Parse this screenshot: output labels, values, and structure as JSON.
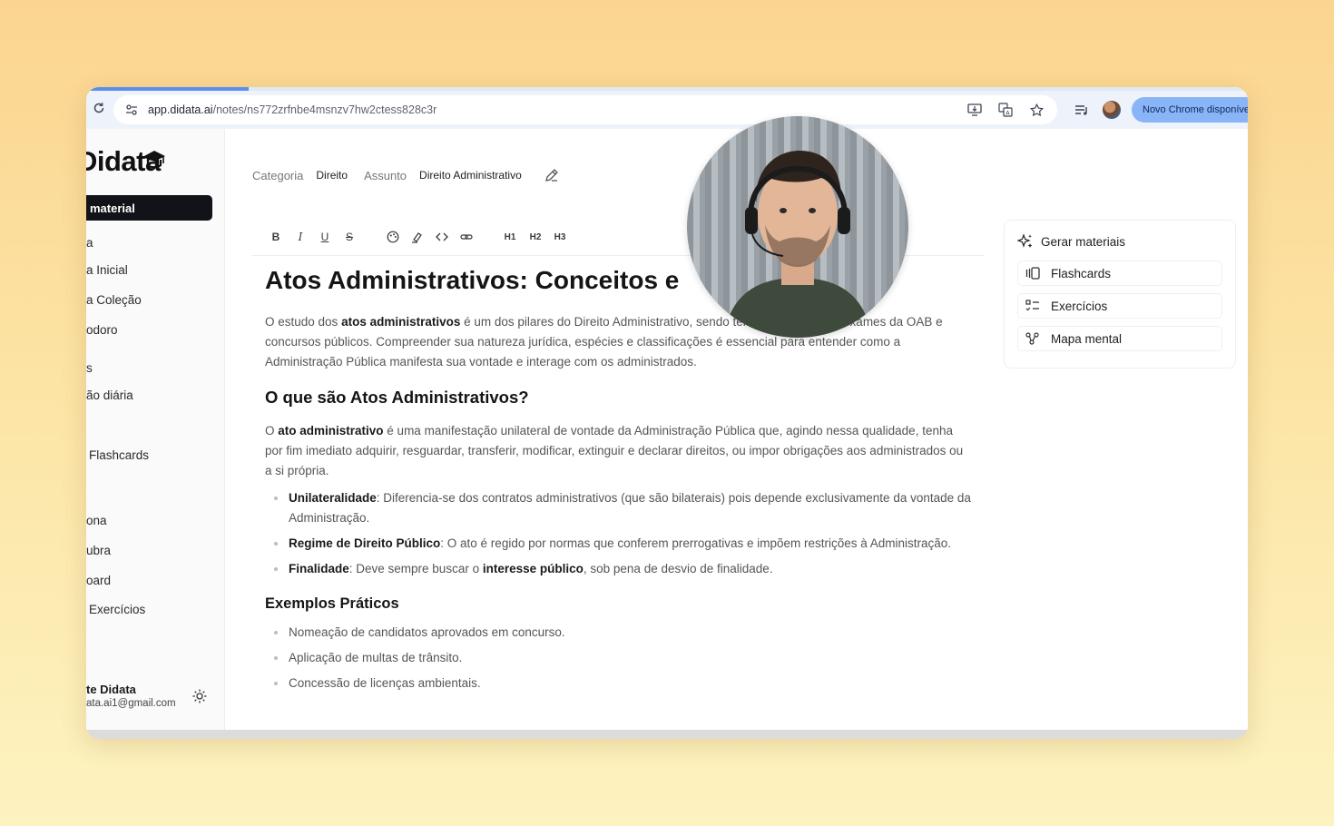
{
  "browser": {
    "url_domain": "app.didata.ai",
    "url_path": "/notes/ns772zrfnbe4msnzv7hw2ctess828c3r",
    "update_label": "Novo Chrome disponível"
  },
  "sidebar": {
    "logo": "Didata",
    "new_button": "material",
    "items": [
      "a",
      "a Inicial",
      "a Coleção",
      "odoro",
      "s",
      "ão diária",
      "Flashcards",
      "ona",
      "ubra",
      "oard",
      "Exercícios"
    ],
    "user_name": "te Didata",
    "user_email": "ata.ai1@gmail.com"
  },
  "meta": {
    "category_label": "Categoria",
    "category_value": "Direito",
    "subject_label": "Assunto",
    "subject_value": "Direito Administrativo"
  },
  "toolbar": {
    "h1": "H1",
    "h2": "H2",
    "h3": "H3"
  },
  "doc": {
    "title": "Atos Administrativos: Conceitos e",
    "intro": {
      "a": "O estudo dos ",
      "b": "atos administrativos",
      "c": " é um dos pilares do Direito Administrativo, sendo tema recorrente em exames da OAB e concursos públicos. Compreender sua natureza jurídica, espécies e classificações é essencial para entender como a Administração Pública manifesta sua vontade e interage com os administrados."
    },
    "h2": "O que são Atos Administrativos?",
    "def": {
      "a": "O ",
      "b": "ato administrativo",
      "c": " é uma manifestação unilateral de vontade da Administração Pública que, agindo nessa qualidade, tenha por fim imediato adquirir, resguardar, transferir, modificar, extinguir e declarar direitos, ou impor obrigações aos administrados ou a si própria."
    },
    "bullets": [
      {
        "term": "Unilateralidade",
        "text": ": Diferencia-se dos contratos administrativos (que são bilaterais) pois depende exclusivamente da vontade da Administração."
      },
      {
        "term": "Regime de Direito Público",
        "text": ": O ato é regido por normas que conferem prerrogativas e impõem restrições à Administração."
      },
      {
        "term": "Finalidade",
        "text": ": Deve sempre buscar o ",
        "term2": "interesse público",
        "text2": ", sob pena de desvio de finalidade."
      }
    ],
    "h3": "Exemplos Práticos",
    "examples": [
      "Nomeação de candidatos aprovados em concurso.",
      "Aplicação de multas de trânsito.",
      "Concessão de licenças ambientais."
    ]
  },
  "panel": {
    "title": "Gerar materiais",
    "buttons": [
      "Flashcards",
      "Exercícios",
      "Mapa mental"
    ]
  }
}
